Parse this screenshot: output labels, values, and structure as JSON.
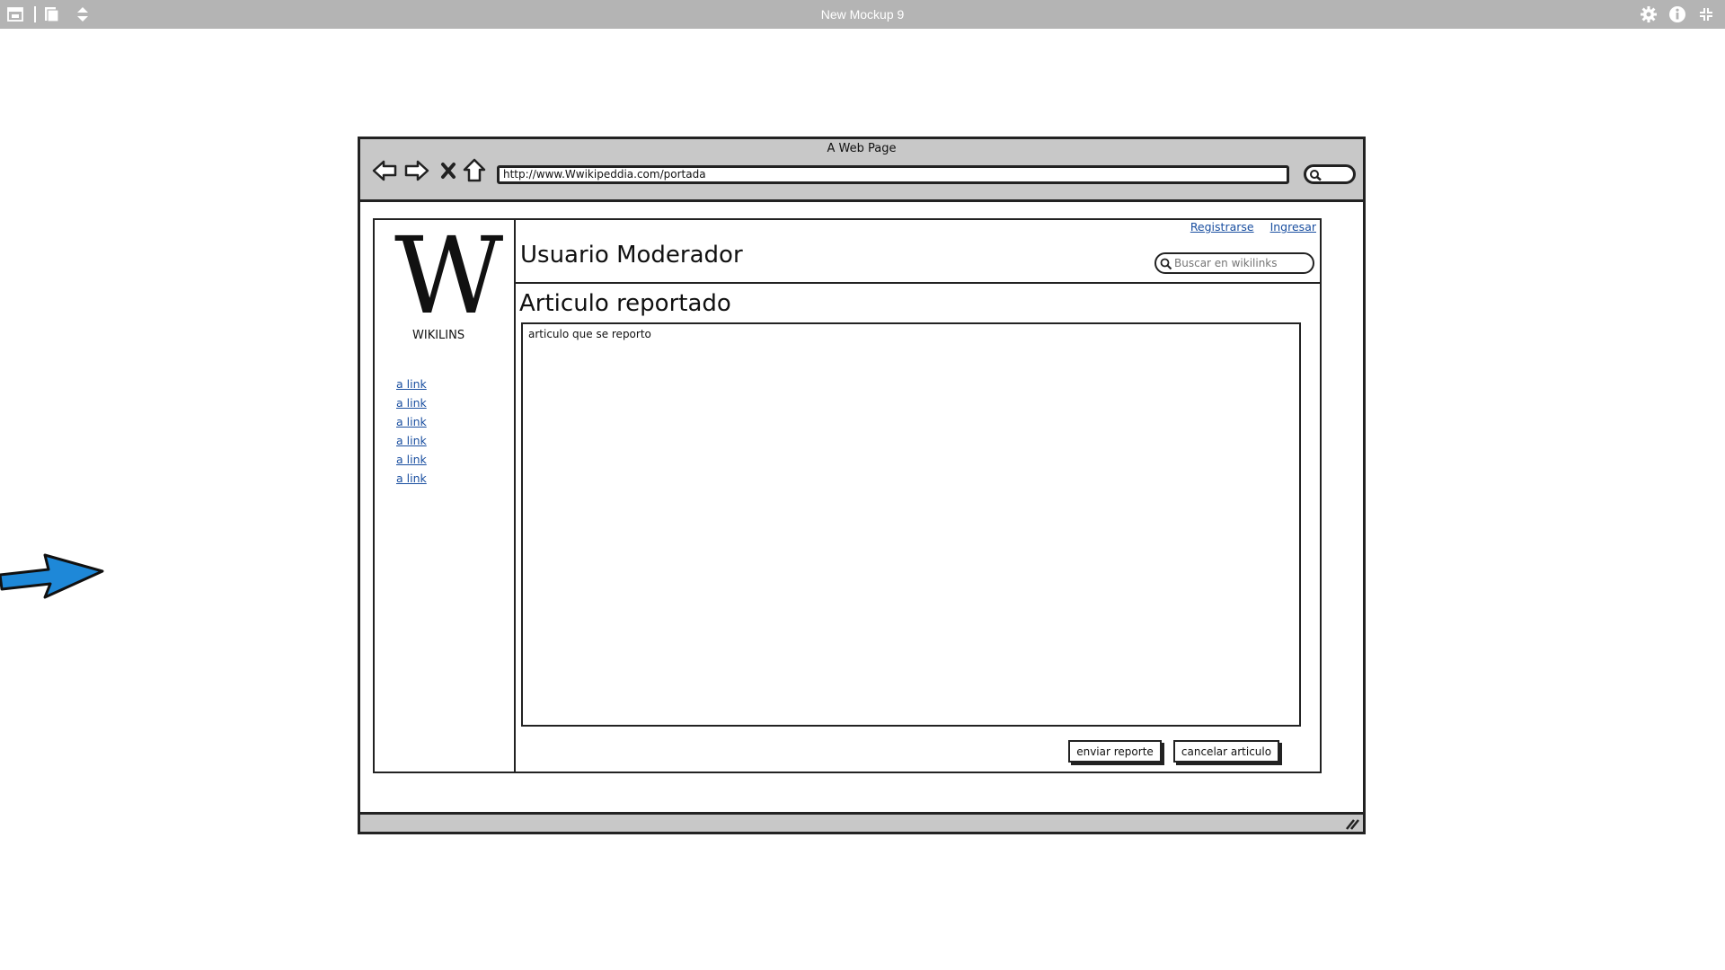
{
  "app": {
    "title": "New Mockup 9"
  },
  "browser": {
    "title": "A Web Page",
    "url": "http://www.Wwikipeddia.com/portada"
  },
  "page": {
    "logo_letter": "W",
    "logo_text": "WIKILINS",
    "sidebar_links": [
      "a link",
      "a link",
      "a link",
      "a link",
      "a link",
      "a link"
    ],
    "top_links": {
      "register": "Registrarse",
      "login": "Ingresar"
    },
    "user_title": "Usuario Moderador",
    "search_placeholder": "Buscar en wikilinks",
    "section_title": "Articulo reportado",
    "report_text": "articulo que se reporto",
    "buttons": {
      "send": "enviar reporte",
      "cancel": "cancelar articulo"
    }
  },
  "colors": {
    "app_bar": "#b4b4b4",
    "browser_chrome": "#c8c8c8",
    "link": "#1a4fa0",
    "arrow": "#1e88d8"
  }
}
